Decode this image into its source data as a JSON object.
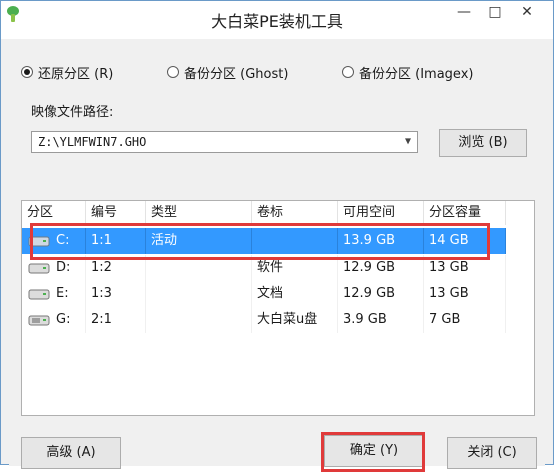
{
  "window": {
    "title": "大白菜PE装机工具",
    "minimize_glyph": "—",
    "maximize_glyph": "□",
    "close_glyph": "✕"
  },
  "modes": [
    {
      "label": "还原分区 (R)",
      "selected": true
    },
    {
      "label": "备份分区 (Ghost)",
      "selected": false
    },
    {
      "label": "备份分区 (Imagex)",
      "selected": false
    }
  ],
  "image_path": {
    "label": "映像文件路径:",
    "value": "Z:\\YLMFWIN7.GHO",
    "browse_label": "浏览 (B)"
  },
  "partition_table": {
    "columns": [
      "分区",
      "编号",
      "类型",
      "卷标",
      "可用空间",
      "分区容量"
    ],
    "rows": [
      {
        "drive": "C:",
        "number": "1:1",
        "type": "活动",
        "label": "",
        "free": "13.9 GB",
        "capacity": "14 GB",
        "selected": true,
        "icon": "drive-icon"
      },
      {
        "drive": "D:",
        "number": "1:2",
        "type": "",
        "label": "软件",
        "free": "12.9 GB",
        "capacity": "13 GB",
        "selected": false,
        "icon": "drive-icon"
      },
      {
        "drive": "E:",
        "number": "1:3",
        "type": "",
        "label": "文档",
        "free": "12.9 GB",
        "capacity": "13 GB",
        "selected": false,
        "icon": "drive-icon"
      },
      {
        "drive": "G:",
        "number": "2:1",
        "type": "",
        "label": "大白菜u盘",
        "free": "3.9 GB",
        "capacity": "7 GB",
        "selected": false,
        "icon": "usb-drive-icon"
      }
    ]
  },
  "buttons": {
    "advanced": "高级 (A)",
    "ok": "确定 (Y)",
    "close": "关闭 (C)"
  },
  "colors": {
    "selection": "#3399ff",
    "annotation": "#e03a3a"
  }
}
